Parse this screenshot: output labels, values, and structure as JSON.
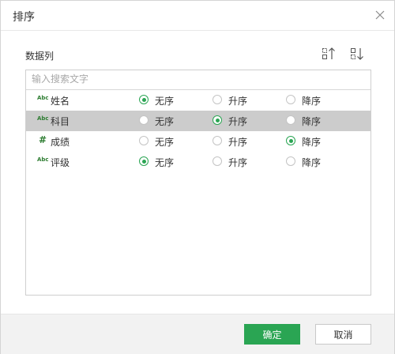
{
  "dialog": {
    "title": "排序",
    "close_icon": "close-icon",
    "section_label": "数据列",
    "sort_asc_icon": "sort-ascending-icon",
    "sort_desc_icon": "sort-descending-icon"
  },
  "search": {
    "placeholder": "输入搜索文字"
  },
  "options": {
    "none": "无序",
    "asc": "升序",
    "desc": "降序"
  },
  "fields": [
    {
      "type_label": "Abc",
      "type": "text",
      "name": "姓名",
      "order": "none",
      "selected": false
    },
    {
      "type_label": "Abc",
      "type": "text",
      "name": "科目",
      "order": "asc",
      "selected": true
    },
    {
      "type_label": "#",
      "type": "number",
      "name": "成绩",
      "order": "desc",
      "selected": false
    },
    {
      "type_label": "Abc",
      "type": "text",
      "name": "评级",
      "order": "none",
      "selected": false
    }
  ],
  "footer": {
    "ok_label": "确定",
    "cancel_label": "取消"
  },
  "colors": {
    "accent": "#2aa553",
    "selected_row": "#cccccc",
    "type_icon": "#2e7d32"
  }
}
